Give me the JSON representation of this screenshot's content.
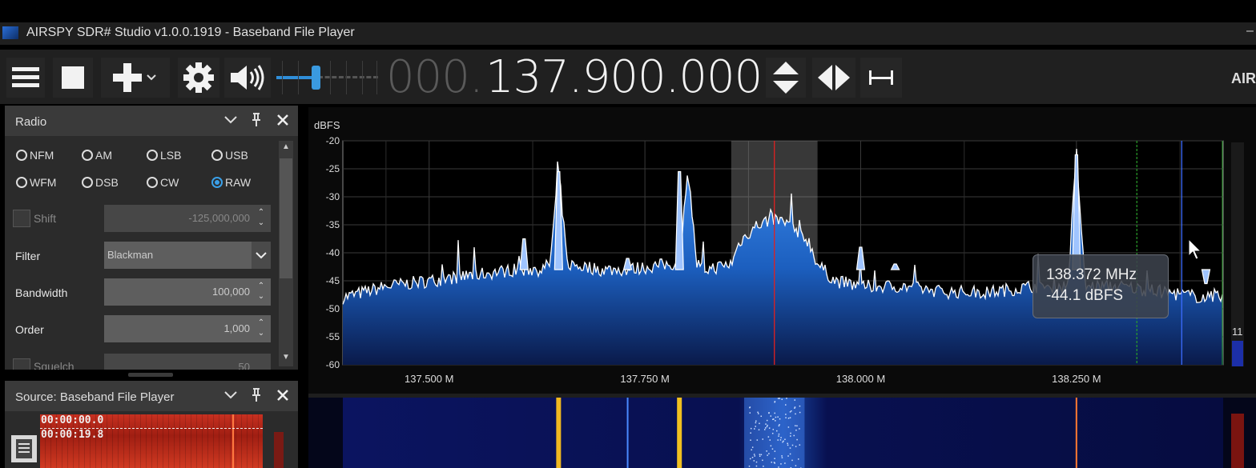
{
  "window": {
    "title": "AIRSPY SDR# Studio v1.0.0.1919 - Baseband File Player",
    "minimize_glyph": "–"
  },
  "toolbar": {
    "freq_lead": "000.",
    "freq_main": "137.900.000",
    "brand": "AIR",
    "icons": [
      "menu-icon",
      "stop-icon",
      "add-icon",
      "dropdown-icon",
      "settings-icon",
      "speaker-icon",
      "updown-arrows-icon",
      "leftright-arrows-icon",
      "span-icon"
    ],
    "volume_level": 0.4
  },
  "radio_panel": {
    "title": "Radio",
    "modes_row1": [
      "NFM",
      "AM",
      "LSB",
      "USB"
    ],
    "modes_row2": [
      "WFM",
      "DSB",
      "CW",
      "RAW"
    ],
    "selected_mode": "RAW",
    "shift_label": "Shift",
    "shift_value": "-125,000,000",
    "filter_label": "Filter",
    "filter_value": "Blackman",
    "bandwidth_label": "Bandwidth",
    "bandwidth_value": "100,000",
    "order_label": "Order",
    "order_value": "1,000",
    "squelch_label": "Squelch",
    "squelch_value": "50"
  },
  "source_panel": {
    "title": "Source: Baseband File Player",
    "time_start": "00:00:00.0",
    "time_end": "00:00:19.8"
  },
  "spectrum": {
    "unit_label": "dBFS",
    "y_ticks": [
      "-20",
      "-25",
      "-30",
      "-35",
      "-40",
      "-45",
      "-50",
      "-55",
      "-60"
    ],
    "x_ticks": [
      "137.500 M",
      "137.750 M",
      "138.000 M",
      "138.250 M"
    ],
    "tooltip_freq": "138.372 MHz",
    "tooltip_level": "-44.1 dBFS",
    "side_number": "11",
    "colors": {
      "fill": "#1c5fbf",
      "trace": "#ffffff",
      "center": "#e02020",
      "cursor_blue": "#3c6cff",
      "cursor_green": "#2aa02a"
    }
  },
  "chart_data": {
    "type": "area",
    "xlabel": "",
    "ylabel": "dBFS",
    "xlim": [
      137.4,
      138.42
    ],
    "ylim": [
      -60,
      -20
    ],
    "grid": true,
    "x": [
      137.4,
      137.45,
      137.5,
      137.55,
      137.6,
      137.63,
      137.64,
      137.65,
      137.66,
      137.7,
      137.73,
      137.78,
      137.79,
      137.8,
      137.81,
      137.82,
      137.85,
      137.86,
      137.88,
      137.9,
      137.92,
      137.94,
      137.95,
      137.97,
      138.0,
      138.05,
      138.1,
      138.15,
      138.2,
      138.23,
      138.24,
      138.25,
      138.26,
      138.3,
      138.35,
      138.4,
      138.42
    ],
    "y": [
      -48,
      -46,
      -45,
      -44,
      -43,
      -43,
      -42,
      -25,
      -42,
      -43,
      -43,
      -42,
      -42,
      -25,
      -42,
      -43,
      -42,
      -38,
      -35,
      -34,
      -35,
      -38,
      -42,
      -45,
      -46,
      -46,
      -47,
      -47,
      -46,
      -46,
      -46,
      -22,
      -46,
      -46,
      -47,
      -48,
      -48
    ]
  }
}
